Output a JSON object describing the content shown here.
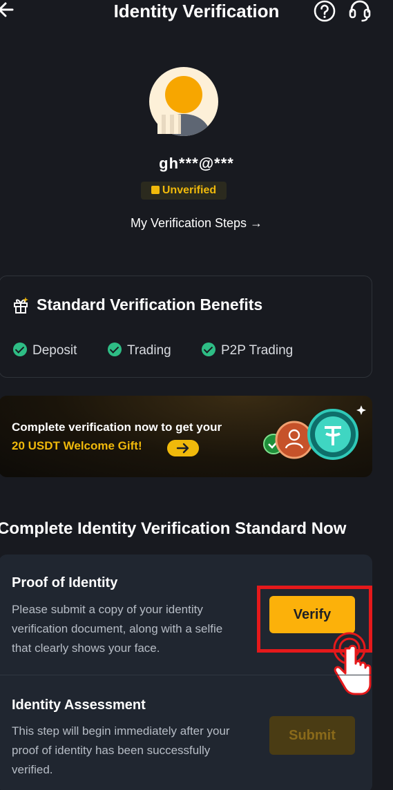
{
  "header": {
    "title": "Identity Verification",
    "back_icon": "arrow-left-icon",
    "help_icon": "question-circle-icon",
    "support_icon": "headset-icon"
  },
  "profile": {
    "username": "gh***@***",
    "status_badge": "Unverified",
    "steps_link": "My Verification Steps →"
  },
  "benefits": {
    "title": "Standard Verification Benefits",
    "items": [
      "Deposit",
      "Trading",
      "P2P Trading"
    ]
  },
  "promo": {
    "line1": "Complete verification now to get your",
    "line2": "20 USDT Welcome Gift!"
  },
  "section": {
    "title": "Complete Identity Verification Standard Now"
  },
  "steps": [
    {
      "title": "Proof of Identity",
      "description": "Please submit a copy of your identity verification document, along with a selfie that clearly shows your face.",
      "button": "Verify"
    },
    {
      "title": "Identity Assessment",
      "description": "This step will begin immediately after your proof of identity has been successfully verified.",
      "button": "Submit"
    }
  ],
  "colors": {
    "accent": "#f0b90b",
    "background": "#181a20",
    "success": "#2ebd85",
    "highlight": "#e5191b"
  }
}
